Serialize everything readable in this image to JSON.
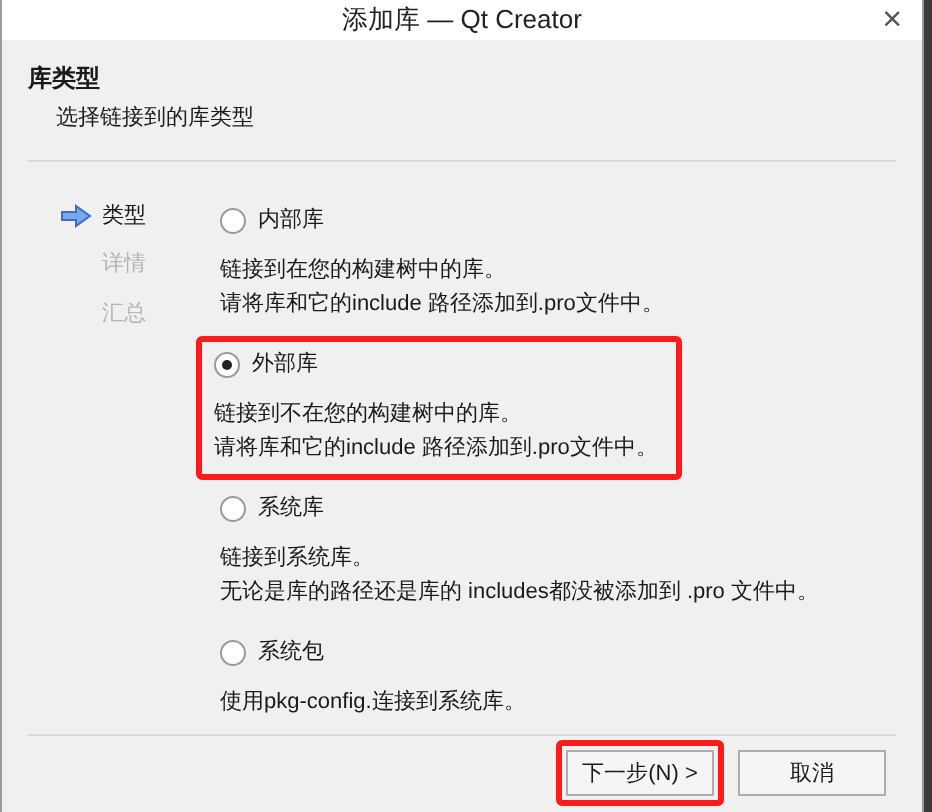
{
  "window": {
    "title": "添加库 — Qt Creator",
    "close": "×"
  },
  "header": {
    "title": "库类型",
    "subtitle": "选择链接到的库类型"
  },
  "steps": [
    {
      "label": "类型",
      "selected": true
    },
    {
      "label": "详情",
      "selected": false
    },
    {
      "label": "汇总",
      "selected": false
    }
  ],
  "options": [
    {
      "label": "内部库",
      "selected": false,
      "highlighted": false,
      "description": [
        "链接到在您的构建树中的库。",
        "请将库和它的include 路径添加到.pro文件中。"
      ]
    },
    {
      "label": "外部库",
      "selected": true,
      "highlighted": true,
      "description": [
        "链接到不在您的构建树中的库。",
        "请将库和它的include 路径添加到.pro文件中。"
      ]
    },
    {
      "label": "系统库",
      "selected": false,
      "highlighted": false,
      "description": [
        "链接到系统库。",
        "无论是库的路径还是库的 includes都没被添加到 .pro 文件中。"
      ]
    },
    {
      "label": "系统包",
      "selected": false,
      "highlighted": false,
      "description": [
        "使用pkg-config.连接到系统库。"
      ]
    }
  ],
  "buttons": [
    {
      "label": "下一步(N) >",
      "highlighted": true
    },
    {
      "label": "取消",
      "highlighted": false
    }
  ]
}
